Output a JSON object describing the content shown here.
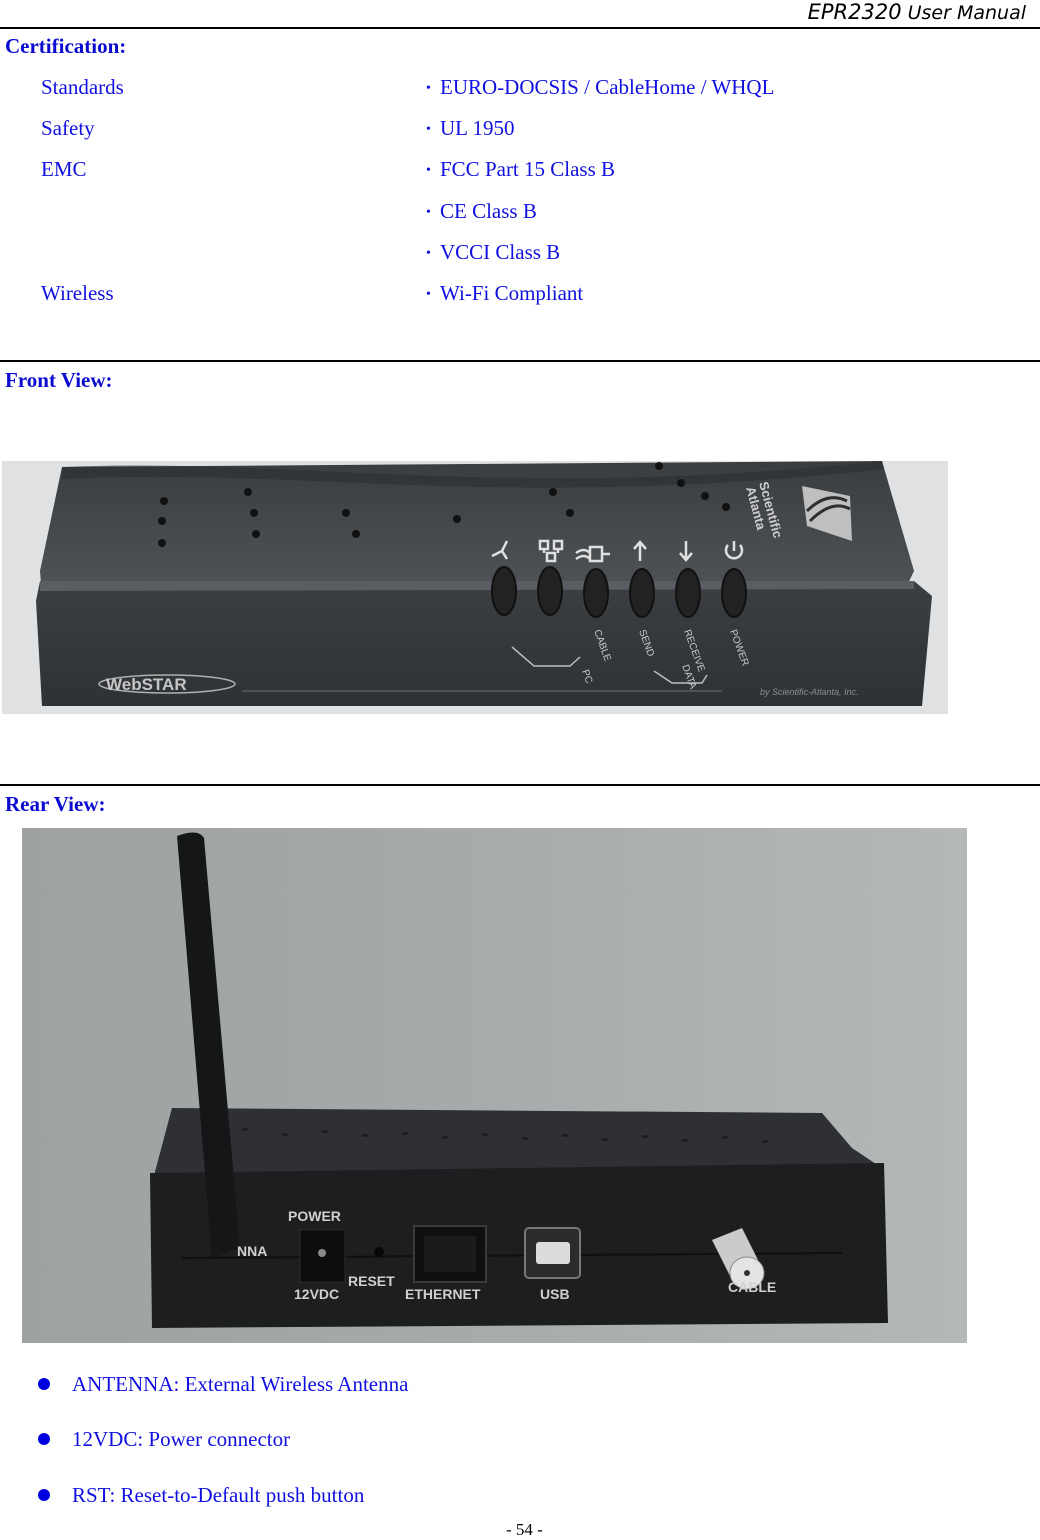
{
  "header": {
    "model": "EPR2320",
    "title": "User Manual"
  },
  "certification": {
    "heading": "Certification:",
    "rows": [
      {
        "label": "Standards",
        "value": "EURO-DOCSIS / CableHome / WHQL"
      },
      {
        "label": "Safety",
        "value": "UL 1950"
      },
      {
        "label": "EMC",
        "value": "FCC Part 15 Class B"
      },
      {
        "label": "",
        "value": "CE Class B"
      },
      {
        "label": "",
        "value": "VCCI Class B"
      },
      {
        "label": "Wireless",
        "value": "Wi-Fi Compliant"
      }
    ],
    "bullet_glyph": "•"
  },
  "front_view": {
    "heading": "Front View:",
    "photo": {
      "brand_logo": "WebSTAR",
      "maker_logo_line1": "Scientific",
      "maker_logo_line2": "Atlanta",
      "footer_text": "by Scientific-Atlanta, Inc.",
      "leds": [
        {
          "icon": "wireless-icon",
          "label": ""
        },
        {
          "icon": "network-icon",
          "label": ""
        },
        {
          "icon": "cable-icon",
          "label": "CABLE"
        },
        {
          "icon": "arrow-up-icon",
          "label": "SEND"
        },
        {
          "icon": "arrow-down-icon",
          "label": "RECEIVE"
        },
        {
          "icon": "power-icon",
          "label": "POWER"
        }
      ],
      "group_labels": {
        "pc": "PC",
        "data": "DATA"
      }
    }
  },
  "rear_view": {
    "heading": "Rear View:",
    "photo": {
      "ports": {
        "antenna": "NNA",
        "power_top": "POWER",
        "power_bottom": "12VDC",
        "reset": "RESET",
        "ethernet": "ETHERNET",
        "usb": "USB",
        "cable": "CABLE"
      }
    },
    "items": [
      "ANTENNA: External Wireless Antenna",
      "12VDC: Power connector",
      "RST: Reset-to-Default push button"
    ]
  },
  "footer": {
    "page_number": "- 54 -"
  }
}
